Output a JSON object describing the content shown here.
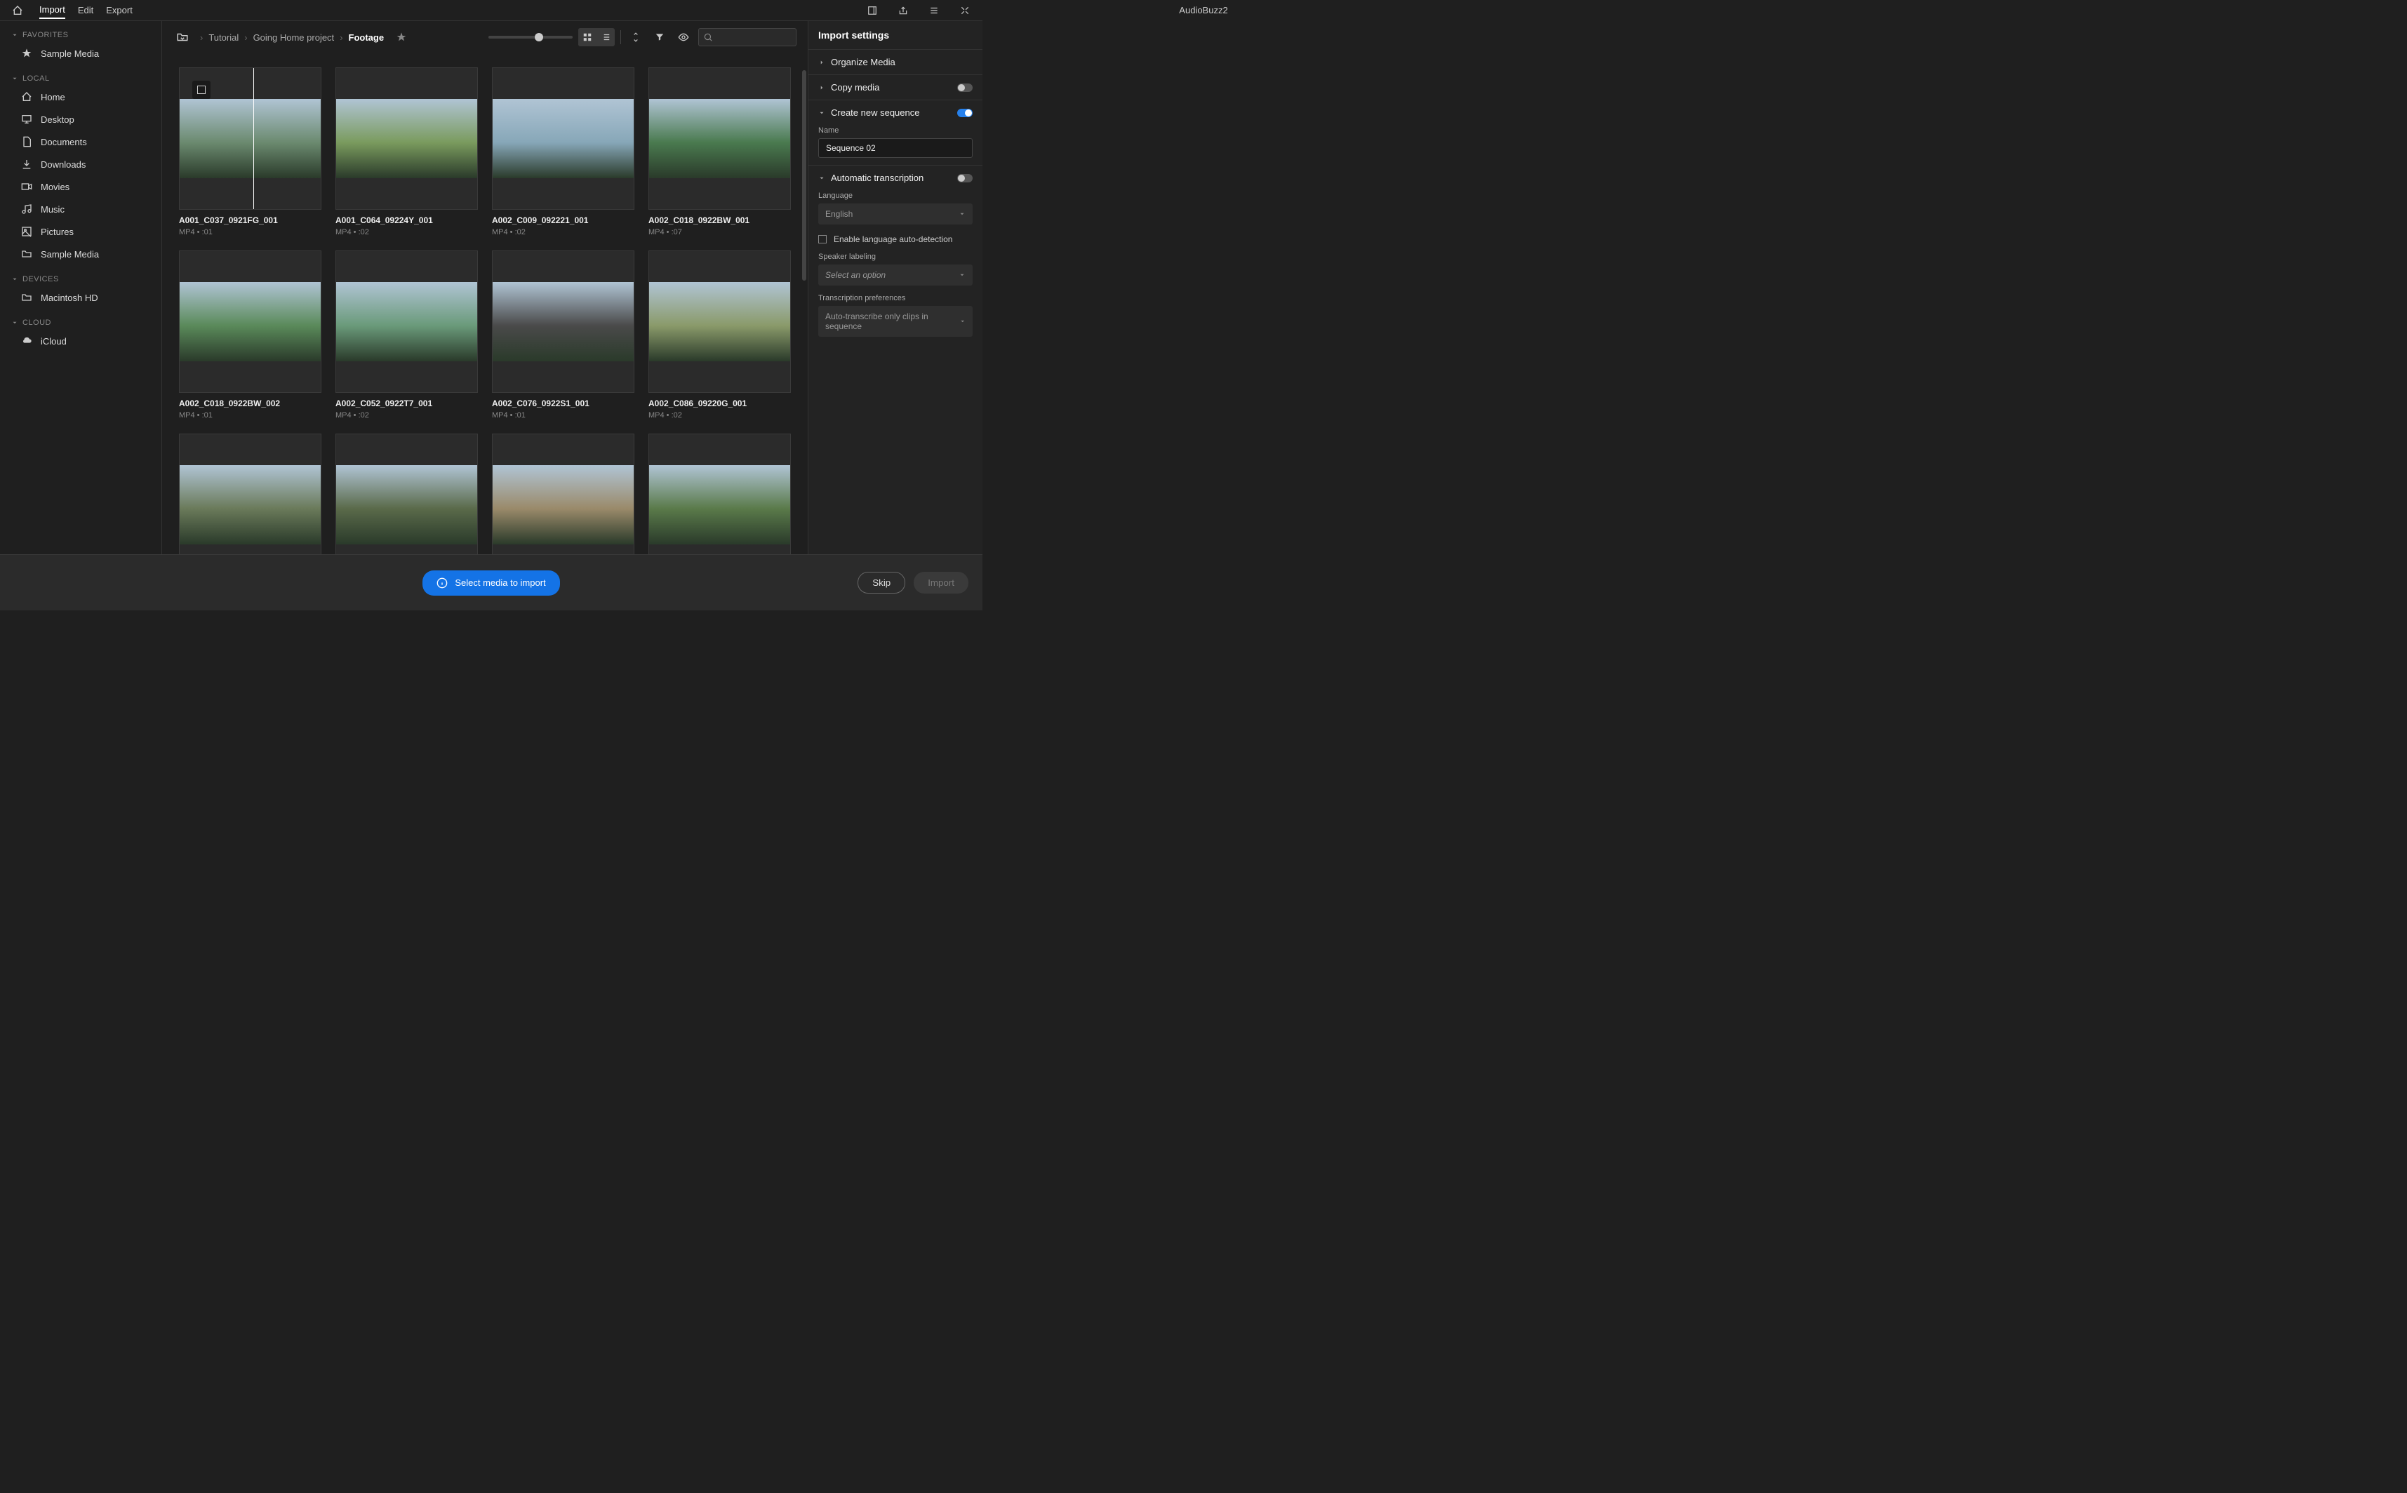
{
  "app": {
    "project_title": "AudioBuzz2"
  },
  "top_nav": {
    "import": "Import",
    "edit": "Edit",
    "export": "Export"
  },
  "sidebar": {
    "favorites": {
      "label": "FAVORITES",
      "items": [
        {
          "label": "Sample Media",
          "icon": "star"
        }
      ]
    },
    "local": {
      "label": "LOCAL",
      "items": [
        {
          "label": "Home",
          "icon": "home"
        },
        {
          "label": "Desktop",
          "icon": "monitor"
        },
        {
          "label": "Documents",
          "icon": "file"
        },
        {
          "label": "Downloads",
          "icon": "download"
        },
        {
          "label": "Movies",
          "icon": "camera"
        },
        {
          "label": "Music",
          "icon": "music"
        },
        {
          "label": "Pictures",
          "icon": "image"
        },
        {
          "label": "Sample Media",
          "icon": "folder"
        }
      ]
    },
    "devices": {
      "label": "DEVICES",
      "items": [
        {
          "label": "Macintosh HD",
          "icon": "folder"
        }
      ]
    },
    "cloud": {
      "label": "CLOUD",
      "items": [
        {
          "label": "iCloud",
          "icon": "cloud"
        }
      ]
    }
  },
  "breadcrumb": {
    "items": [
      "Tutorial",
      "Going Home project",
      "Footage"
    ]
  },
  "clips": [
    {
      "name": "A001_C037_0921FG_001",
      "format": "MP4",
      "duration": ":01",
      "selected": true
    },
    {
      "name": "A001_C064_09224Y_001",
      "format": "MP4",
      "duration": ":02"
    },
    {
      "name": "A002_C009_092221_001",
      "format": "MP4",
      "duration": ":02"
    },
    {
      "name": "A002_C018_0922BW_001",
      "format": "MP4",
      "duration": ":07"
    },
    {
      "name": "A002_C018_0922BW_002",
      "format": "MP4",
      "duration": ":01"
    },
    {
      "name": "A002_C052_0922T7_001",
      "format": "MP4",
      "duration": ":02"
    },
    {
      "name": "A002_C076_0922S1_001",
      "format": "MP4",
      "duration": ":01"
    },
    {
      "name": "A002_C086_09220G_001",
      "format": "MP4",
      "duration": ":02"
    },
    {
      "name": "",
      "format": "",
      "duration": ""
    },
    {
      "name": "",
      "format": "",
      "duration": ""
    },
    {
      "name": "",
      "format": "",
      "duration": ""
    },
    {
      "name": "",
      "format": "",
      "duration": ""
    }
  ],
  "settings": {
    "title": "Import settings",
    "organize": "Organize Media",
    "copy": "Copy media",
    "create_seq": "Create new sequence",
    "name_label": "Name",
    "seq_name": "Sequence 02",
    "auto_trans": "Automatic transcription",
    "language_label": "Language",
    "language_value": "English",
    "lang_detect": "Enable language auto-detection",
    "speaker_label": "Speaker labeling",
    "speaker_value": "Select an option",
    "trans_pref_label": "Transcription preferences",
    "trans_pref_value": "Auto-transcribe only clips in sequence"
  },
  "footer": {
    "info_text": "Select media to import",
    "skip": "Skip",
    "import": "Import"
  }
}
